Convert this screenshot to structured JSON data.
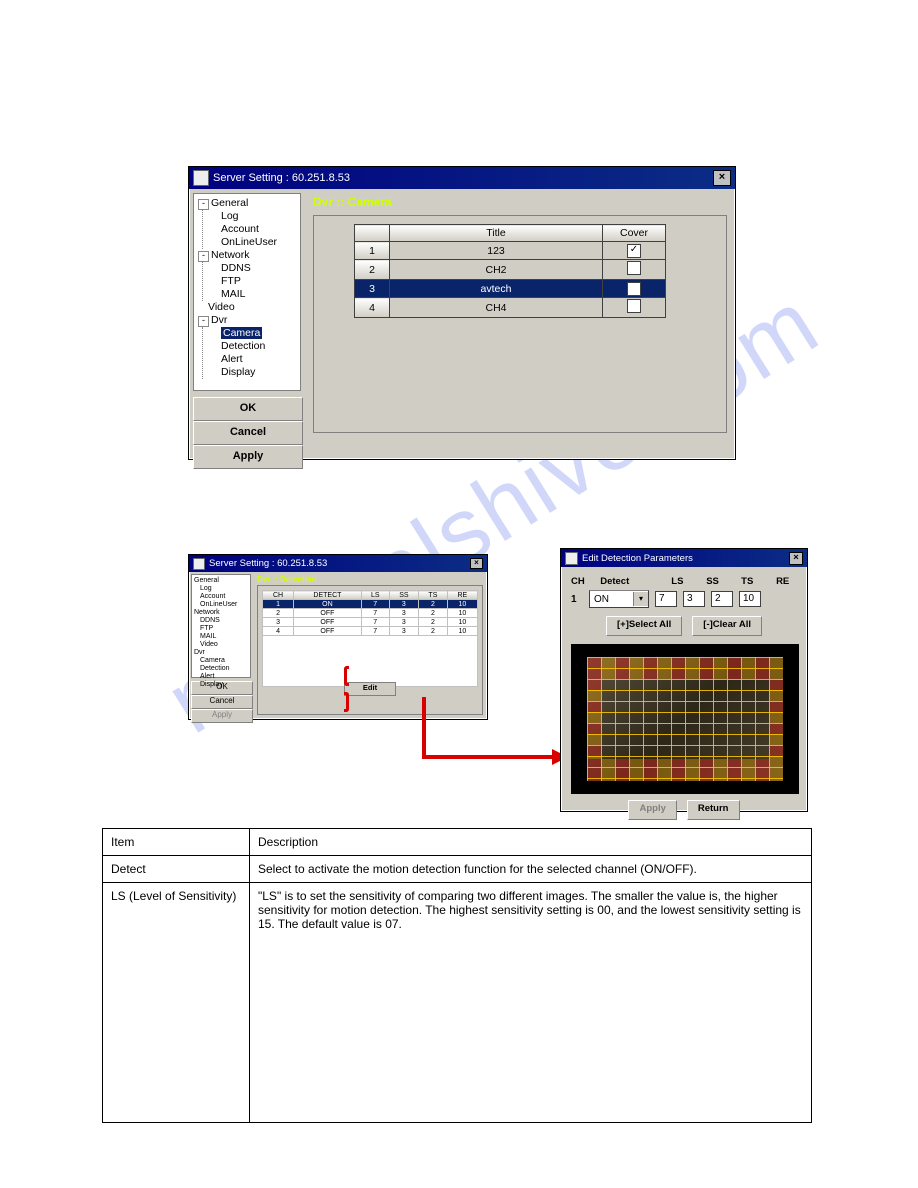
{
  "screenshot1": {
    "title": "Server Setting : 60.251.8.53",
    "panel_title": "Dvr :: Camera",
    "tree": {
      "general": "General",
      "log": "Log",
      "account": "Account",
      "onlineuser": "OnLineUser",
      "network": "Network",
      "ddns": "DDNS",
      "ftp": "FTP",
      "mail": "MAIL",
      "video": "Video",
      "dvr": "Dvr",
      "camera": "Camera",
      "detection": "Detection",
      "alert": "Alert",
      "display": "Display"
    },
    "buttons": {
      "ok": "OK",
      "cancel": "Cancel",
      "apply": "Apply"
    },
    "table": {
      "headers": {
        "blank": "",
        "title": "Title",
        "cover": "Cover"
      },
      "rows": [
        {
          "idx": "1",
          "title": "123",
          "cover": true
        },
        {
          "idx": "2",
          "title": "CH2",
          "cover": false
        },
        {
          "idx": "3",
          "title": "avtech",
          "cover": true,
          "selected": true
        },
        {
          "idx": "4",
          "title": "CH4",
          "cover": false
        }
      ]
    }
  },
  "screenshot2": {
    "title": "Server Setting : 60.251.8.53",
    "panel_title": "Dvr :: Detection",
    "tree": {
      "general": "General",
      "log": "Log",
      "account": "Account",
      "onlineuser": "OnLineUser",
      "network": "Network",
      "ddns": "DDNS",
      "ftp": "FTP",
      "mail": "MAIL",
      "video": "Video",
      "dvr": "Dvr",
      "camera": "Camera",
      "detection": "Detection",
      "alert": "Alert",
      "display": "Display"
    },
    "buttons": {
      "ok": "OK",
      "cancel": "Cancel",
      "apply": "Apply"
    },
    "edit": "Edit",
    "table": {
      "headers": [
        "CH",
        "DETECT",
        "LS",
        "SS",
        "TS",
        "RE"
      ],
      "rows": [
        [
          "1",
          "ON",
          "7",
          "3",
          "2",
          "10"
        ],
        [
          "2",
          "OFF",
          "7",
          "3",
          "2",
          "10"
        ],
        [
          "3",
          "OFF",
          "7",
          "3",
          "2",
          "10"
        ],
        [
          "4",
          "OFF",
          "7",
          "3",
          "2",
          "10"
        ]
      ],
      "selected_row": 0
    }
  },
  "screenshot3": {
    "title": "Edit Detection Parameters",
    "labels": {
      "ch": "CH",
      "detect": "Detect",
      "ls": "LS",
      "ss": "SS",
      "ts": "TS",
      "re": "RE"
    },
    "values": {
      "ch": "1",
      "detect": "ON",
      "ls": "7",
      "ss": "3",
      "ts": "2",
      "re": "10"
    },
    "buttons": {
      "select_all": "[+]Select All",
      "clear_all": "[-]Clear All",
      "apply": "Apply",
      "return": "Return"
    }
  },
  "desc_table": {
    "row1": {
      "item": "Item",
      "desc": "Description"
    },
    "row2": {
      "item": "Detect",
      "desc": "Select to activate the motion detection function for the selected channel (ON/OFF)."
    },
    "row3": {
      "item": "LS (Level of Sensitivity)",
      "desc": "\"LS\" is to set the sensitivity of comparing two different images. The smaller the value is, the higher sensitivity for motion detection. The highest sensitivity setting is 00, and the lowest sensitivity setting is 15. The default value is 07."
    }
  }
}
